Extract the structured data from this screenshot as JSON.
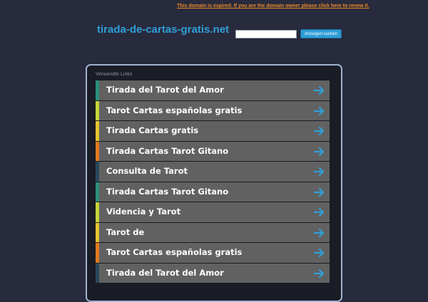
{
  "banner": {
    "expired_text": "This domain is expired. If you are the domain owner please click here to renew it."
  },
  "header": {
    "domain_name": "tirada-de-cartas-gratis.net",
    "search_value": "",
    "search_button_label": "Anzeigen suchen"
  },
  "links_section": {
    "title": "Verwandte Links",
    "arrow_icon": "right-arrow-icon",
    "arrow_color": "#2fa0d8",
    "items": [
      {
        "label": "Tirada del Tarot del Amor",
        "accent": "#2a8f7a"
      },
      {
        "label": "Tarot Cartas españolas gratis",
        "accent": "#c7d438"
      },
      {
        "label": "Tirada Cartas gratis",
        "accent": "#e5c42e"
      },
      {
        "label": "Tirada Cartas Tarot Gitano",
        "accent": "#e07a1f"
      },
      {
        "label": "Consulta de Tarot",
        "accent": "#28485e"
      },
      {
        "label": "Tirada Cartas Tarot Gitano",
        "accent": "#2a8f7a"
      },
      {
        "label": "Videncia y Tarot",
        "accent": "#c7d438"
      },
      {
        "label": "Tarot de",
        "accent": "#e5c42e"
      },
      {
        "label": "Tarot Cartas españolas gratis",
        "accent": "#e07a1f"
      },
      {
        "label": "Tirada del Tarot del Amor",
        "accent": "#28485e"
      }
    ]
  }
}
